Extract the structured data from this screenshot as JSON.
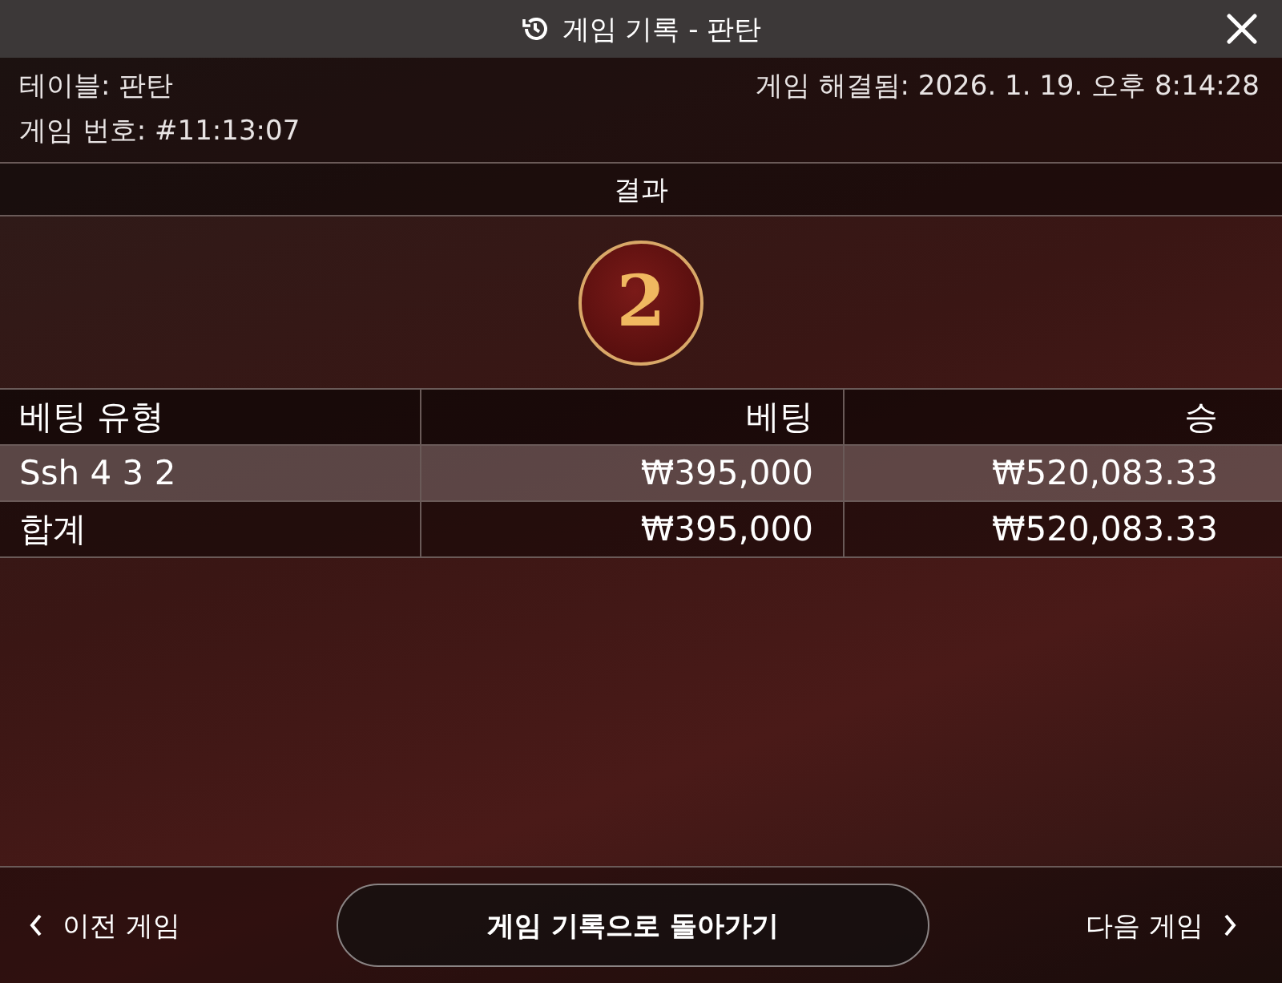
{
  "window": {
    "title": "게임 기록 - 판탄"
  },
  "info": {
    "table": "테이블: 판탄",
    "game_number": "게임 번호: #11:13:07",
    "resolved": "게임 해결됨: 2026. 1. 19. 오후 8:14:28"
  },
  "result": {
    "heading": "결과",
    "value": "2"
  },
  "table": {
    "columns": [
      "베팅 유형",
      "베팅",
      "승"
    ],
    "rows": [
      {
        "cells": [
          "Ssh 4 3 2",
          "₩395,000",
          "₩520,083.33"
        ],
        "highlighted": true
      },
      {
        "cells": [
          "합계",
          "₩395,000",
          "₩520,083.33"
        ],
        "highlighted": false
      }
    ]
  },
  "footer": {
    "previous": "이전 게임",
    "back": "게임 기록으로 돌아가기",
    "next": "다음 게임"
  }
}
